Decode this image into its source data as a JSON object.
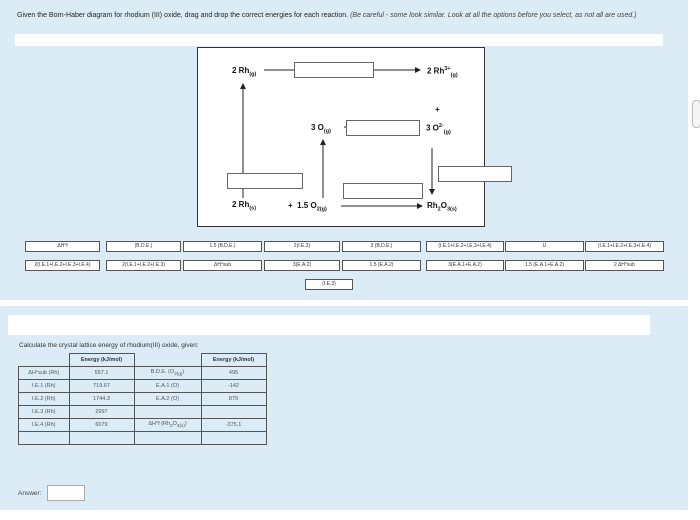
{
  "instructions": {
    "main": "Given the Born-Haber diagram for rhodium (III) oxide, drag and drop the correct energies for each reaction.",
    "note": "(Be careful - some look similar. Look at all the options before you select, as not all are used.)"
  },
  "diagram": {
    "top_left": {
      "base": "2 Rh",
      "sub": "(g)"
    },
    "top_right": {
      "base": "2 Rh",
      "sup": "3+",
      "sub": "(g)"
    },
    "plus": "+",
    "mid_left": {
      "base": "3 O",
      "sub": "(g)"
    },
    "mid_right": {
      "base": "3 O",
      "sup": "2-",
      "sub": "(g)"
    },
    "bottom_left": {
      "base": "2 Rh",
      "sub": "(s)"
    },
    "bottom_mid": {
      "prefix": "+",
      "base": "1.5 O",
      "sub": "2(g)"
    },
    "bottom_right": {
      "base": "Rh",
      "sub1": "2",
      "mid": "O",
      "sub2": "3(s)"
    }
  },
  "options": [
    "ΔH°f",
    "(B.D.E.)",
    "1.5 (B.D.E.)",
    "2(I.E.3)",
    "3 (B.D.E.)",
    "(I.E.1+I.E.2+I.E.3+I.E.4)",
    "U",
    "(I.E.1+I.E.2+I.E.3+I.E.4)",
    "2(I.E.1+I.E.2+I.E.3+I.E.4)",
    "2(I.E.1+I.E.2+I.E.3)",
    "ΔH°sub",
    "3(E.A.2)",
    "1.5 (E.A.2)",
    "3(E.A.1+E.A.2)",
    "1.5 (E.A.1+E.A.2)",
    "2 ΔH°sub",
    "(I.E.3)"
  ],
  "question": "Calculate the crystal lattice energy of rhodium(III) oxide, given:",
  "table": {
    "header": [
      "Energy (kJ/mol)",
      "Energy (kJ/mol)"
    ],
    "rows": [
      {
        "l": "ΔH°sub (Rh)",
        "lv": "557.1",
        "r": "B.D.E. (O",
        "rsub": "2(g)",
        "rclose": ")",
        "rv": "495"
      },
      {
        "l": "I.E.1 (Rh)",
        "lv": "719.67",
        "r": "E.A.1 (O)",
        "rsub": "",
        "rclose": "",
        "rv": "-142"
      },
      {
        "l": "I.E.2 (Rh)",
        "lv": "1744.3",
        "r": "E.A.2 (O)",
        "rsub": "",
        "rclose": "",
        "rv": "879"
      },
      {
        "l": "I.E.3 (Rh)",
        "lv": "2997",
        "r": "",
        "rsub": "",
        "rclose": "",
        "rv": ""
      },
      {
        "l": "I.E.4 (Rh)",
        "lv": "6079",
        "r": "ΔH°f (Rh",
        "rsub": "2",
        "rmid": "O",
        "rsub2": "3(s)",
        "rclose": ")",
        "rv": "-375.1"
      }
    ]
  },
  "answer": {
    "label": "Answer:",
    "value": ""
  }
}
